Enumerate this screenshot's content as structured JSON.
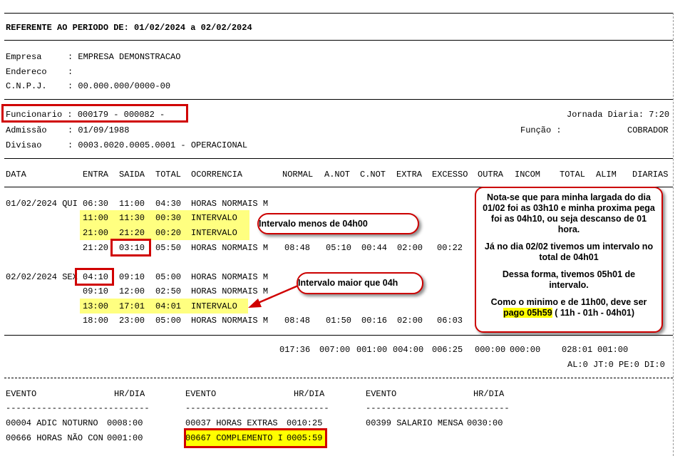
{
  "header": {
    "periodo": "REFERENTE AO PERIODO DE: 01/02/2024 a 02/02/2024"
  },
  "company": {
    "empresa_label": "Empresa",
    "empresa_value": ": EMPRESA DEMONSTRACAO",
    "endereco_label": "Endereco",
    "endereco_value": ":",
    "cnpj_label": "C.N.P.J.",
    "cnpj_value": ": 00.000.000/0000-00"
  },
  "employee": {
    "funcionario": "Funcionario : 000179 - 000082 -",
    "jornada": "Jornada Diaria: 7:20",
    "admissao_label": "Admissão",
    "admissao_value": ": 01/09/1988",
    "funcao_label": "Função :",
    "funcao_value": "COBRADOR",
    "divisao_label": "Divisao",
    "divisao_value": ": 0003.0020.0005.0001 - OPERACIONAL"
  },
  "columns": [
    "DATA",
    "ENTRA",
    "SAIDA",
    "TOTAL",
    "OCORRENCIA",
    "NORMAL",
    "A.NOT",
    "C.NOT",
    "EXTRA",
    "EXCESSO",
    "OUTRA",
    "INCOM",
    "TOTAL",
    "ALIM",
    "DIARIAS"
  ],
  "rows": [
    {
      "data": "01/02/2024 QUI",
      "entra": "06:30",
      "saida": "11:00",
      "total": "04:30",
      "ocorrencia": "HORAS NORMAIS M"
    },
    {
      "data": "",
      "entra": "11:00",
      "saida": "11:30",
      "total": "00:30",
      "ocorrencia": "INTERVALO"
    },
    {
      "data": "",
      "entra": "21:00",
      "saida": "21:20",
      "total": "00:20",
      "ocorrencia": "INTERVALO"
    },
    {
      "data": "",
      "entra": "21:20",
      "saida": "03:10",
      "total": "05:50",
      "ocorrencia": "HORAS NORMAIS M",
      "normal": "08:48",
      "anot": "05:10",
      "cnot": "00:44",
      "extra": "02:00",
      "excesso": "00:22"
    },
    {
      "data": "02/02/2024 SEX",
      "entra": "04:10",
      "saida": "09:10",
      "total": "05:00",
      "ocorrencia": "HORAS NORMAIS M"
    },
    {
      "data": "",
      "entra": "09:10",
      "saida": "12:00",
      "total": "02:50",
      "ocorrencia": "HORAS NORMAIS M"
    },
    {
      "data": "",
      "entra": "13:00",
      "saida": "17:01",
      "total": "04:01",
      "ocorrencia": "INTERVALO"
    },
    {
      "data": "",
      "entra": "18:00",
      "saida": "23:00",
      "total": "05:00",
      "ocorrencia": "HORAS NORMAIS M",
      "normal": "08:48",
      "anot": "01:50",
      "cnot": "00:16",
      "extra": "02:00",
      "excesso": "06:03"
    }
  ],
  "totals": {
    "normal": "017:36",
    "anot": "007:00",
    "cnot": "001:00",
    "extra": "004:00",
    "excesso": "006:25",
    "outra": "000:00",
    "incom": "000:00",
    "total": "028:01",
    "alim": "001:00",
    "flags": "AL:0 JT:0 PE:0 DI:0"
  },
  "events_header": {
    "evento": "EVENTO",
    "hrdia": "HR/DIA",
    "underline": "----------------------------"
  },
  "events": [
    {
      "label": "00004 ADIC NOTURNO",
      "value": "0008:00"
    },
    {
      "label": "00037 HORAS EXTRAS",
      "value": "0010:25"
    },
    {
      "label": "00399 SALARIO MENSA",
      "value": "0030:00"
    },
    {
      "label": "00666 HORAS NÃO CON",
      "value": "0001:00"
    },
    {
      "label": "00667 COMPLEMENTO I",
      "value": "0005:59"
    }
  ],
  "annotations": {
    "callout_menos": "Intervalo menos de 04h00",
    "callout_maior": "Intervalo maior que 04h",
    "note_p1": "Nota-se que para minha largada do dia 01/02 foi as 03h10 e minha proxima pega foi as 04h10, ou seja descanso de 01 hora.",
    "note_p2": "Já no dia 02/02 tivemos um intervalo no total de 04h01",
    "note_p3": "Dessa forma, tivemos 05h01 de intervalo.",
    "note_p4a": "Como o minimo e de 11h00, deve ser",
    "note_p4b_hl": "pago 05h59",
    "note_p4c": " ( 11h - 01h - 04h01)"
  },
  "colors": {
    "highlight": "#ffff80",
    "highlight_strong": "#ffff00",
    "annotation_red": "#d00000"
  }
}
